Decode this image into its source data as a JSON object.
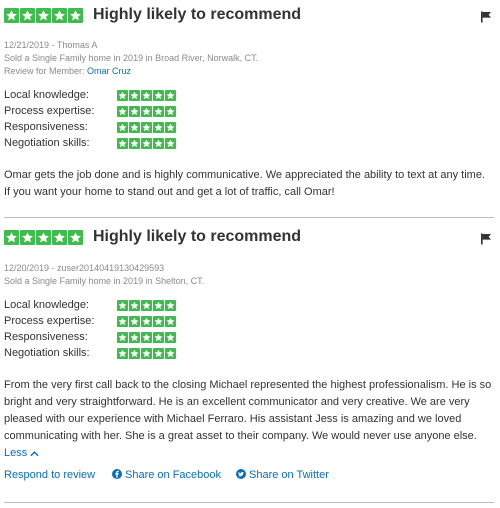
{
  "colors": {
    "star_green": "#3fbc4d",
    "link_blue": "#0a6cba",
    "text": "#333333",
    "meta_gray": "#8a8a8a"
  },
  "icons": {
    "star": "star-icon",
    "flag": "flag-icon",
    "facebook": "facebook-icon",
    "twitter": "twitter-icon",
    "chevron": "chevron-up-icon"
  },
  "reviews": [
    {
      "stars": 5,
      "title": "Highly likely to recommend",
      "date_author": "12/21/2019 - Thomas A",
      "transaction": "Sold a Single Family home in 2019 in Broad River, Norwalk, CT.",
      "member_prefix": "Review for Member: ",
      "member_name": "Omar Cruz",
      "skills": [
        {
          "label": "Local knowledge:",
          "stars": 5
        },
        {
          "label": "Process expertise:",
          "stars": 5
        },
        {
          "label": "Responsiveness:",
          "stars": 5
        },
        {
          "label": "Negotiation skills:",
          "stars": 5
        }
      ],
      "text": "Omar gets the job done and is highly communicative. We appreciated the ability to text at any time. If you want your home to stand out and get a lot of traffic, call Omar!"
    },
    {
      "stars": 5,
      "title": "Highly likely to recommend",
      "date_author": "12/20/2019 - zuser20140419130429593",
      "transaction": "Sold a Single Family home in 2019 in Shelton, CT.",
      "skills": [
        {
          "label": "Local knowledge:",
          "stars": 5
        },
        {
          "label": "Process expertise:",
          "stars": 5
        },
        {
          "label": "Responsiveness:",
          "stars": 5
        },
        {
          "label": "Negotiation skills:",
          "stars": 5
        }
      ],
      "text": "From the very first call back to the closing Michael represented the highest professionalism. He is so bright and very straightforward. He is an excellent communicator and very creative. We are very pleased with our experience with Michael Ferraro. His assistant Jess is amazing and we loved  communicating with her. She is a great asset to their company. We would never use anyone else.",
      "less_label": "Less",
      "actions": {
        "respond": "Respond to review",
        "facebook": "Share on Facebook",
        "twitter": "Share on Twitter"
      }
    }
  ]
}
